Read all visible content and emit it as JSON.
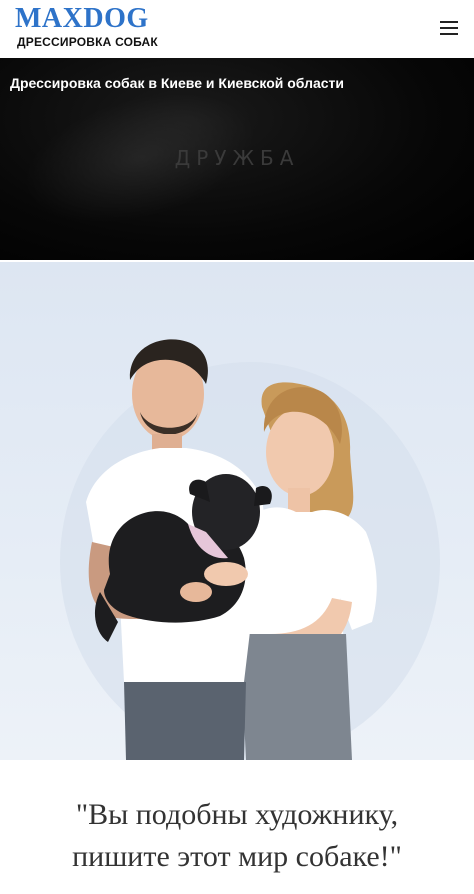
{
  "header": {
    "logo_title": "MAXDOG",
    "logo_subtitle": "ДРЕССИРОВКА СОБАК",
    "menu_icon": "hamburger-menu-icon",
    "brand_color": "#2e73c9"
  },
  "hero": {
    "title": "Дрессировка собак в Киеве и Киевской области",
    "word": "ДРУЖБА"
  },
  "photo": {
    "background_color": "#e3eaf4"
  },
  "quote": {
    "line1": "\"Вы подобны художнику,",
    "line2": "пишите этот мир собаке!\""
  }
}
